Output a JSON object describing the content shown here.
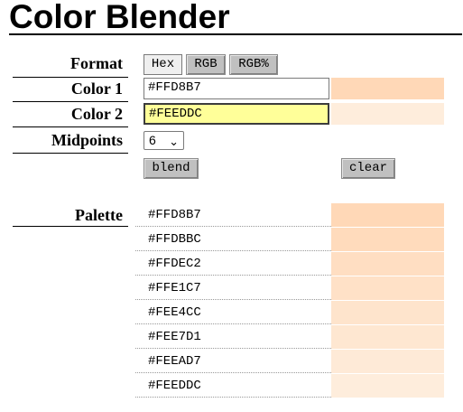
{
  "app": {
    "title": "Color Blender"
  },
  "labels": {
    "format": "Format",
    "color1": "Color 1",
    "color2": "Color 2",
    "midpoints": "Midpoints",
    "palette": "Palette"
  },
  "format_buttons": [
    {
      "label": "Hex",
      "selected": true
    },
    {
      "label": "RGB",
      "selected": false
    },
    {
      "label": "RGB%",
      "selected": false
    }
  ],
  "inputs": {
    "color1": "#FFD8B7",
    "color2": "#FEEDDC"
  },
  "midpoints": {
    "selected": "6"
  },
  "actions": {
    "blend": "blend",
    "clear": "clear"
  },
  "palette": [
    {
      "hex": "#FFD8B7",
      "color": "#FFD8B7"
    },
    {
      "hex": "#FFDBBC",
      "color": "#FFDBBC"
    },
    {
      "hex": "#FFDEC2",
      "color": "#FFDEC2"
    },
    {
      "hex": "#FFE1C7",
      "color": "#FFE1C7"
    },
    {
      "hex": "#FEE4CC",
      "color": "#FEE4CC"
    },
    {
      "hex": "#FEE7D1",
      "color": "#FEE7D1"
    },
    {
      "hex": "#FEEAD7",
      "color": "#FEEAD7"
    },
    {
      "hex": "#FEEDDC",
      "color": "#FEEDDC"
    }
  ],
  "colors": {
    "active_field_bg": "#ffff99",
    "button_bg": "#c0c0c0",
    "swatch1": "#FFD8B7",
    "swatch2": "#FEEDDC"
  }
}
